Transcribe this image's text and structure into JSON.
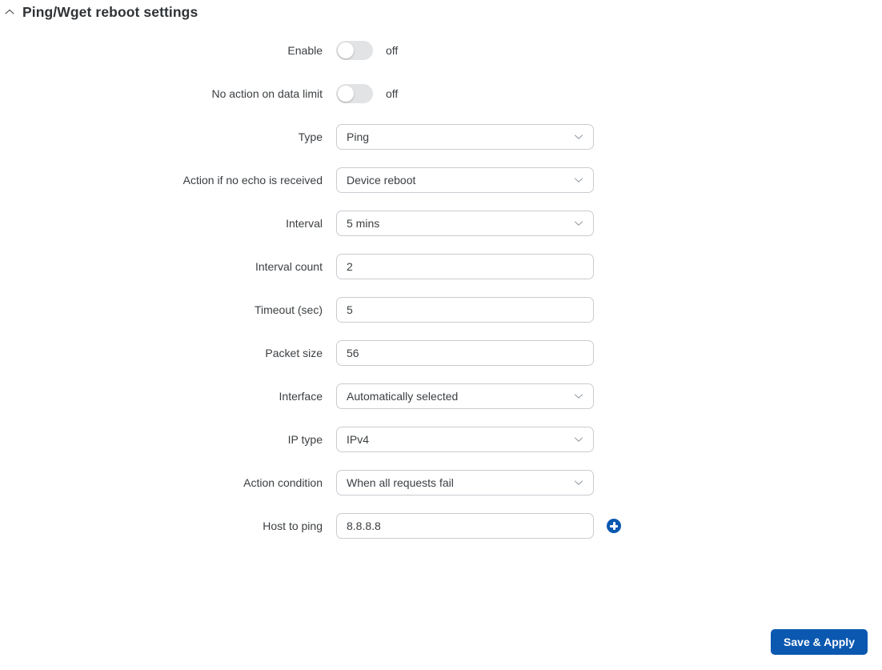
{
  "section": {
    "title": "Ping/Wget reboot settings",
    "collapse_icon": "chevron-up-icon",
    "expanded": true
  },
  "fields": [
    {
      "key": "enable",
      "label": "Enable",
      "type": "toggle",
      "value": "off",
      "state_label": "off"
    },
    {
      "key": "no_action_on_data_limit",
      "label": "No action on data limit",
      "type": "toggle",
      "value": "off",
      "state_label": "off"
    },
    {
      "key": "type",
      "label": "Type",
      "type": "select",
      "value": "Ping"
    },
    {
      "key": "action_if_no_echo",
      "label": "Action if no echo is received",
      "type": "select",
      "value": "Device reboot"
    },
    {
      "key": "interval",
      "label": "Interval",
      "type": "select",
      "value": "5 mins"
    },
    {
      "key": "interval_count",
      "label": "Interval count",
      "type": "text",
      "value": "2"
    },
    {
      "key": "timeout_sec",
      "label": "Timeout (sec)",
      "type": "text",
      "value": "5"
    },
    {
      "key": "packet_size",
      "label": "Packet size",
      "type": "text",
      "value": "56"
    },
    {
      "key": "interface",
      "label": "Interface",
      "type": "select",
      "value": "Automatically selected"
    },
    {
      "key": "ip_type",
      "label": "IP type",
      "type": "select",
      "value": "IPv4"
    },
    {
      "key": "action_condition",
      "label": "Action condition",
      "type": "select",
      "value": "When all requests fail"
    },
    {
      "key": "host_to_ping",
      "label": "Host to ping",
      "type": "text",
      "value": "8.8.8.8",
      "add_button": true,
      "add_button_icon": "plus-icon"
    }
  ],
  "footer": {
    "save_label": "Save & Apply"
  },
  "colors": {
    "accent": "#0a58b0",
    "label_text": "#3b3f42",
    "field_border": "#c9ccd1",
    "toggle_track_off": "#e2e3e5",
    "background": "#ffffff"
  }
}
